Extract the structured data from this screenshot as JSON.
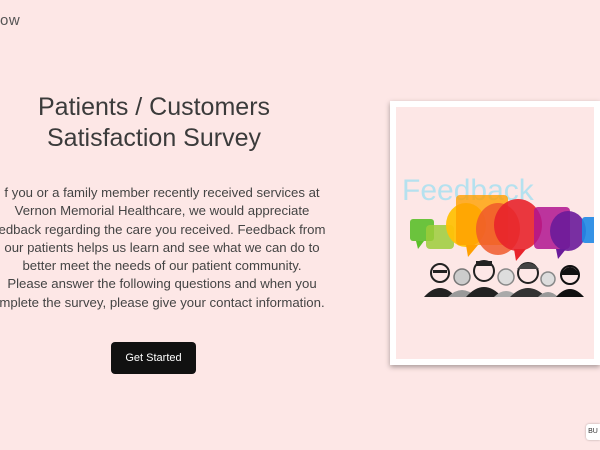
{
  "header": {
    "brand": "ow"
  },
  "survey": {
    "title_line1": "Patients / Customers",
    "title_line2": "Satisfaction Survey",
    "intro_lines": [
      "f you or a family member recently received services at",
      "Vernon Memorial Healthcare, we would appreciate",
      "edback regarding the care you received. Feedback from",
      "our patients helps us learn and see what we can do to",
      "better meet the needs of our patient community.",
      "Please answer the following questions and when you",
      "mplete the survey, please give your contact information."
    ],
    "start_button": "Get Started"
  },
  "illustration": {
    "word": "Feedback"
  },
  "corner_badge": "BU"
}
